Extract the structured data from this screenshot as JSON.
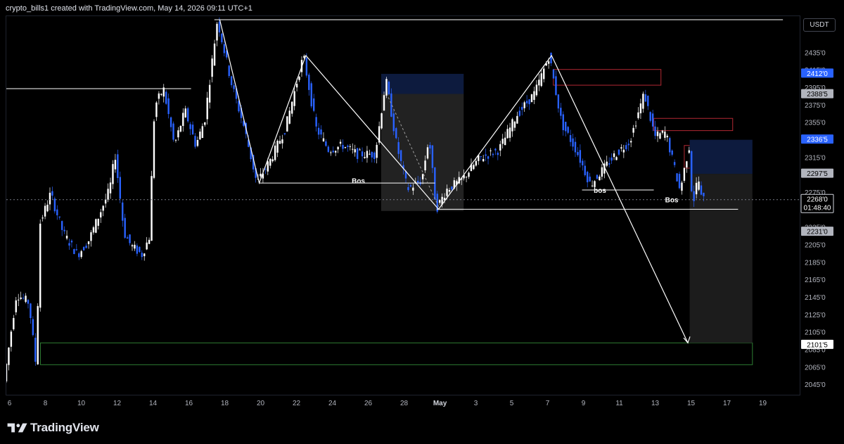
{
  "watermark": "crypto_bills1 created with TradingView.com, May 14, 2026 09:11 UTC+1",
  "brand": "TradingView",
  "currency_label": "USDT",
  "colors": {
    "background": "#000000",
    "candle_up": "#ffffff",
    "candle_down": "#2962ff",
    "zone_red": "#b22833",
    "zone_green": "#2e7d32",
    "blue_zone": "#0d1b3e",
    "gray_zone": "#2a2a2a"
  },
  "chart_data": {
    "type": "candlestick",
    "x_ticks": [
      "6",
      "8",
      "10",
      "12",
      "14",
      "16",
      "18",
      "20",
      "22",
      "24",
      "26",
      "28",
      "May",
      "3",
      "5",
      "7",
      "9",
      "11",
      "13",
      "15",
      "17",
      "19"
    ],
    "y_ticks": [
      24350,
      24150,
      23950,
      23750,
      23550,
      23350,
      23150,
      22950,
      22750,
      22550,
      22350,
      22150,
      21950,
      21750,
      21550,
      21350,
      21150,
      20950,
      20750,
      20550
    ],
    "y_tick_labels": [
      "2435'0",
      "2415'0",
      "2395'0",
      "2375'0",
      "2355'0",
      "2335'0",
      "2315'0",
      "2295'0",
      "2275'0",
      "2255'0",
      "2235'0",
      "2205'0",
      "2185'0",
      "2165'0",
      "2145'0",
      "2125'0",
      "2105'0",
      "2085'0",
      "2065'0",
      "2045'0"
    ],
    "price_badges": [
      {
        "label": "2412'0",
        "value": 24120,
        "style": "blue"
      },
      {
        "label": "2388'5",
        "value": 23885,
        "style": "gray"
      },
      {
        "label": "2336'5",
        "value": 23365,
        "style": "blue"
      },
      {
        "label": "2297'5",
        "value": 22975,
        "style": "gray"
      },
      {
        "label": "2268'0",
        "value": 22680,
        "style": "current"
      },
      {
        "label": "2231'0",
        "value": 22310,
        "style": "gray"
      },
      {
        "label": "2101'5",
        "value": 21015,
        "style": "white"
      }
    ],
    "countdown": "01:48:40",
    "annotations": [
      {
        "text": "Bos",
        "date": "Apr 22",
        "price": 22900
      },
      {
        "text": "bos",
        "date": "May 9",
        "price": 22790
      },
      {
        "text": "Bos",
        "date": "May 13",
        "price": 22680
      }
    ],
    "zigzag": [
      {
        "date": "Apr 17.8",
        "price": 24740
      },
      {
        "date": "Apr 20",
        "price": 22870
      },
      {
        "date": "Apr 22.6",
        "price": 24330
      },
      {
        "date": "Apr 30",
        "price": 22570
      },
      {
        "date": "May 6.3",
        "price": 24330
      },
      {
        "date": "May 13.9",
        "price": 21040
      }
    ],
    "levels": [
      {
        "price": 24740,
        "from": "Apr 17.5",
        "to": "May 19.2"
      },
      {
        "price": 23950,
        "from": "Apr 5",
        "to": "Apr 16.2"
      },
      {
        "price": 22870,
        "from": "Apr 20",
        "to": "Apr 29.8"
      },
      {
        "price": 22570,
        "from": "Apr 29.9",
        "to": "May 16.7"
      },
      {
        "price": 22790,
        "from": "May 8",
        "to": "May 12"
      }
    ],
    "zones": [
      {
        "kind": "red",
        "top": 24170,
        "bottom": 23990,
        "from": "May 6.4",
        "to": "May 12.4"
      },
      {
        "kind": "red",
        "top": 23610,
        "bottom": 23470,
        "from": "May 12",
        "to": "May 16.4"
      },
      {
        "kind": "red",
        "top": 23300,
        "bottom": 23040,
        "from": "May 13.7",
        "to": "May 16.8"
      },
      {
        "kind": "green",
        "top": 21040,
        "bottom": 20790,
        "from": "Apr 7.8",
        "to": "May 17.5"
      },
      {
        "kind": "blue",
        "top": 24120,
        "bottom": 23890,
        "from": "Apr 26.8",
        "to": "May 1.4"
      },
      {
        "kind": "blue",
        "top": 23365,
        "bottom": 22975,
        "from": "May 14",
        "to": "May 17.5"
      }
    ],
    "ylim": [
      20430,
      24780
    ],
    "grid": false,
    "scale": "linear"
  }
}
